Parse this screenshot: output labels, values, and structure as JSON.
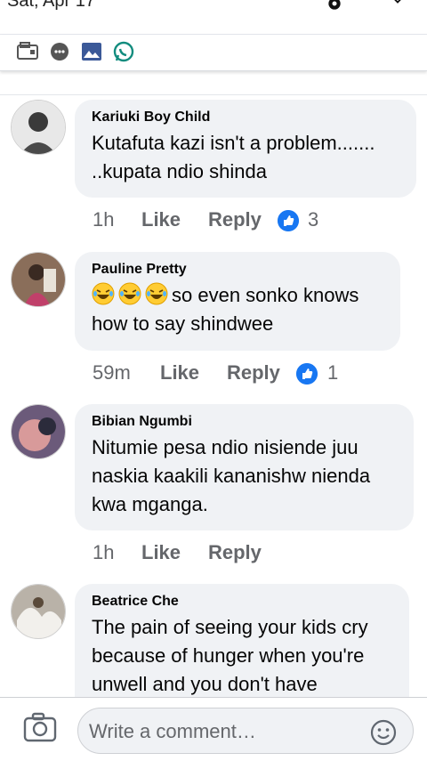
{
  "status": {
    "date": "Sat, Apr 17"
  },
  "notification_icons": [
    "wallet-icon",
    "chat-bubble-icon",
    "gallery-icon",
    "whatsapp-icon"
  ],
  "comments": [
    {
      "author": "Kariuki Boy Child",
      "text": "Kutafuta kazi isn't a problem....... ..kupata ndio shinda",
      "time": "1h",
      "like": "Like",
      "reply": "Reply",
      "reactions": "3"
    },
    {
      "author": "Pauline Pretty",
      "text": "so even sonko knows how to say shindwee",
      "emojis": [
        "laughing-tears-emoji",
        "laughing-tears-emoji",
        "laughing-tears-emoji"
      ],
      "time": "59m",
      "like": "Like",
      "reply": "Reply",
      "reactions": "1"
    },
    {
      "author": "Bibian Ngumbi",
      "text": "Nitumie pesa ndio nisiende juu naskia kaakili kananishw nienda kwa mganga.",
      "time": "1h",
      "like": "Like",
      "reply": "Reply"
    },
    {
      "author": "Beatrice Che",
      "text": "The pain of seeing your kids cry because of hunger when  you're unwell and you don't have"
    }
  ],
  "composer": {
    "placeholder": "Write a comment…"
  },
  "colors": {
    "accent": "#1877f2",
    "bubble": "#f0f2f5",
    "muted": "#65676b"
  }
}
